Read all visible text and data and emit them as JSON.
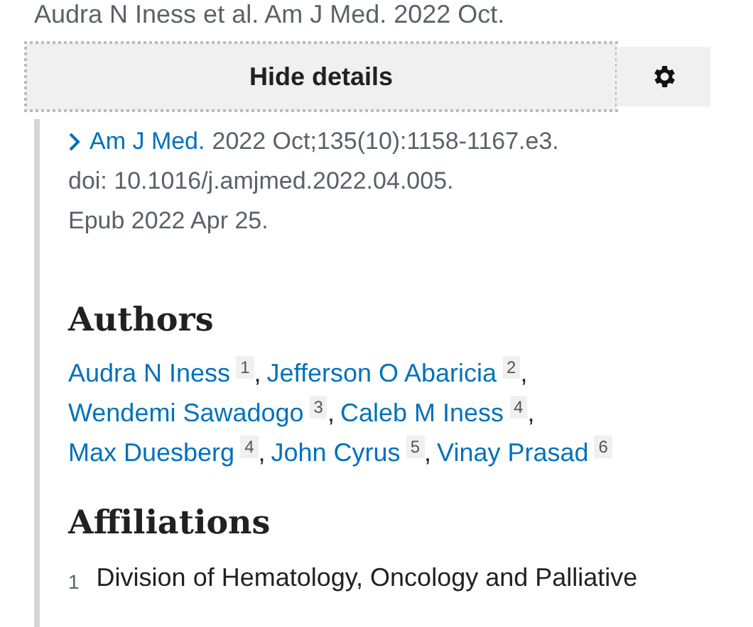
{
  "citation": "Audra N Iness et al. Am J Med. 2022 Oct.",
  "details_button": {
    "label": "Hide details"
  },
  "source": {
    "journal": "Am J Med.",
    "details": "2022 Oct;135(10):1158-1167.e3.",
    "doi": "doi: 10.1016/j.amjmed.2022.04.005.",
    "epub": "Epub 2022 Apr 25."
  },
  "authors": {
    "heading": "Authors",
    "lines": [
      [
        {
          "name": "Audra N Iness",
          "ref": "1",
          "separator": ","
        },
        {
          "name": "Jefferson O Abaricia",
          "ref": "2",
          "separator": ","
        }
      ],
      [
        {
          "name": "Wendemi Sawadogo",
          "ref": "3",
          "separator": ","
        },
        {
          "name": "Caleb M Iness",
          "ref": "4",
          "separator": ","
        }
      ],
      [
        {
          "name": "Max Duesberg",
          "ref": "4",
          "separator": ","
        },
        {
          "name": "John Cyrus",
          "ref": "5",
          "separator": ","
        },
        {
          "name": "Vinay Prasad",
          "ref": "6"
        }
      ]
    ]
  },
  "affiliations": {
    "heading": "Affiliations",
    "items": [
      {
        "number": "1",
        "text": "Division of Hematology, Oncology and Palliative"
      }
    ]
  }
}
